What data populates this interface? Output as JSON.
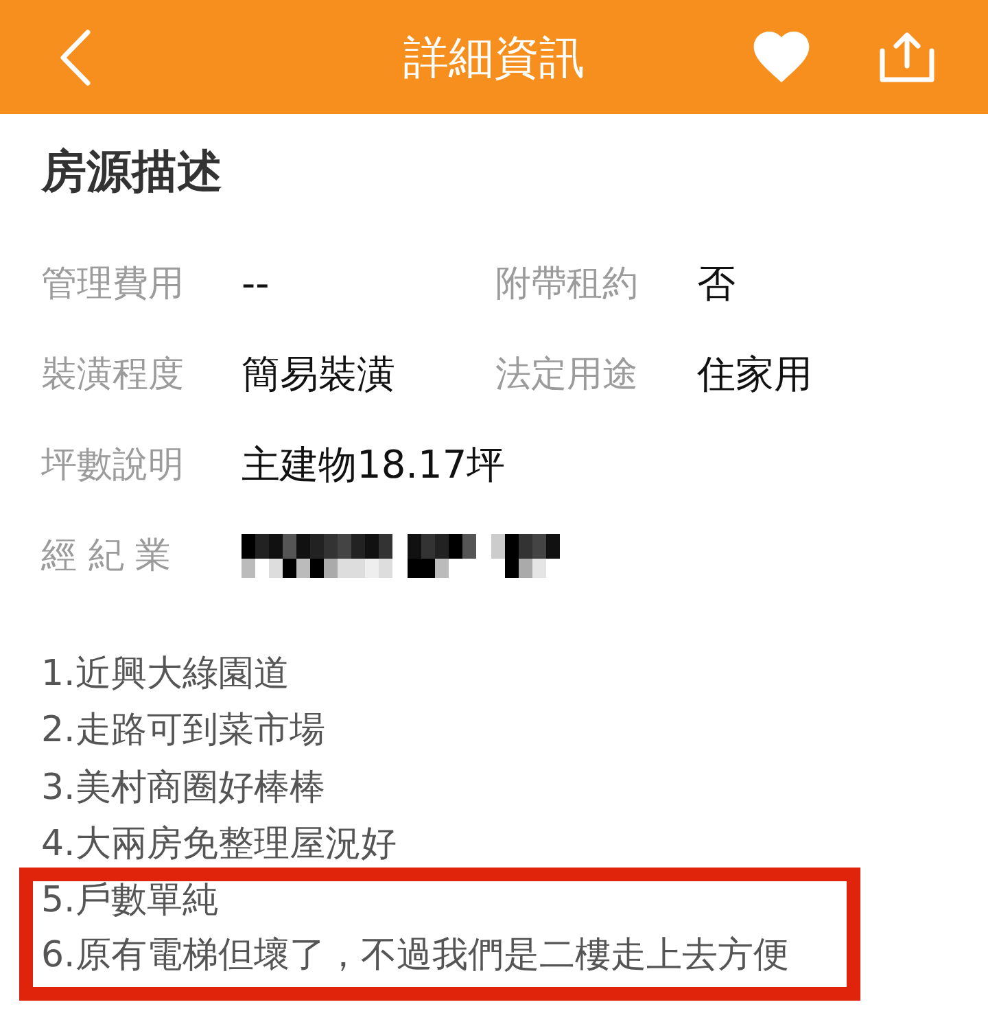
{
  "header": {
    "title": "詳細資訊"
  },
  "section": {
    "title": "房源描述",
    "rows": [
      {
        "fields": [
          {
            "label": "管理費用",
            "kind": "text",
            "value": "--"
          },
          {
            "label": "附帶租約",
            "kind": "text",
            "value": "否"
          }
        ]
      },
      {
        "fields": [
          {
            "label": "裝潢程度",
            "kind": "text",
            "value": "簡易裝潢"
          },
          {
            "label": "法定用途",
            "kind": "text",
            "value": "住家用"
          }
        ]
      },
      {
        "fields": [
          {
            "label": "坪數說明",
            "kind": "text",
            "value": "主建物18.17坪"
          }
        ]
      },
      {
        "fields": [
          {
            "label": "經 紀 業",
            "kind": "redacted"
          }
        ]
      }
    ],
    "description": [
      {
        "text": "1.近興大綠園道",
        "highlighted": false
      },
      {
        "text": "2.走路可到菜市場",
        "highlighted": false
      },
      {
        "text": "3.美村商圈好棒棒",
        "highlighted": false
      },
      {
        "text": "4.大兩房免整理屋況好",
        "highlighted": false
      },
      {
        "text": "5.戶數單純",
        "highlighted": true
      },
      {
        "text": "6.原有電梯但壞了，不過我們是二樓走上去方便",
        "highlighted": true
      }
    ]
  }
}
